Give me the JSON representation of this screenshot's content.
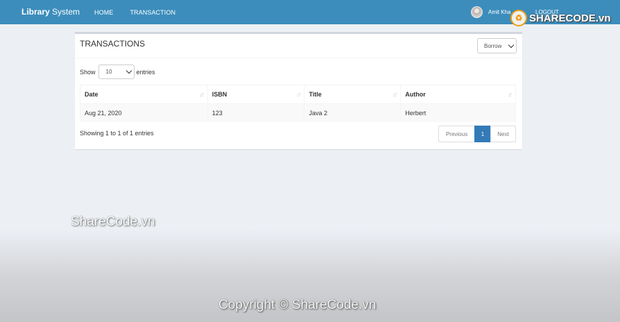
{
  "navbar": {
    "brand_bold": "Library",
    "brand_rest": " System",
    "links": [
      "HOME",
      "TRANSACTION"
    ],
    "user_name": "Amit Kha",
    "logout_label": "LOGOUT"
  },
  "box": {
    "title": "TRANSACTIONS",
    "type_select": "Borrow",
    "length": {
      "prefix": "Show",
      "value": "10",
      "suffix": "entries"
    },
    "table": {
      "headers": [
        "Date",
        "ISBN",
        "Title",
        "Author"
      ],
      "rows": [
        [
          "Aug 21, 2020",
          "123",
          "Java 2",
          "Herbert"
        ]
      ]
    },
    "info": "Showing 1 to 1 of 1 entries",
    "pagination": {
      "previous": "Previous",
      "current": "1",
      "next": "Next"
    }
  },
  "watermarks": {
    "logo_text_1": "SHARE",
    "logo_text_2": "CODE.vn",
    "middle": "ShareCode.vn",
    "bottom": "Copyright © ShareCode.vn"
  },
  "colors": {
    "navbar": "#3c8dbc",
    "page_bg": "#ecf0f5",
    "pagination_active": "#337ab7"
  }
}
